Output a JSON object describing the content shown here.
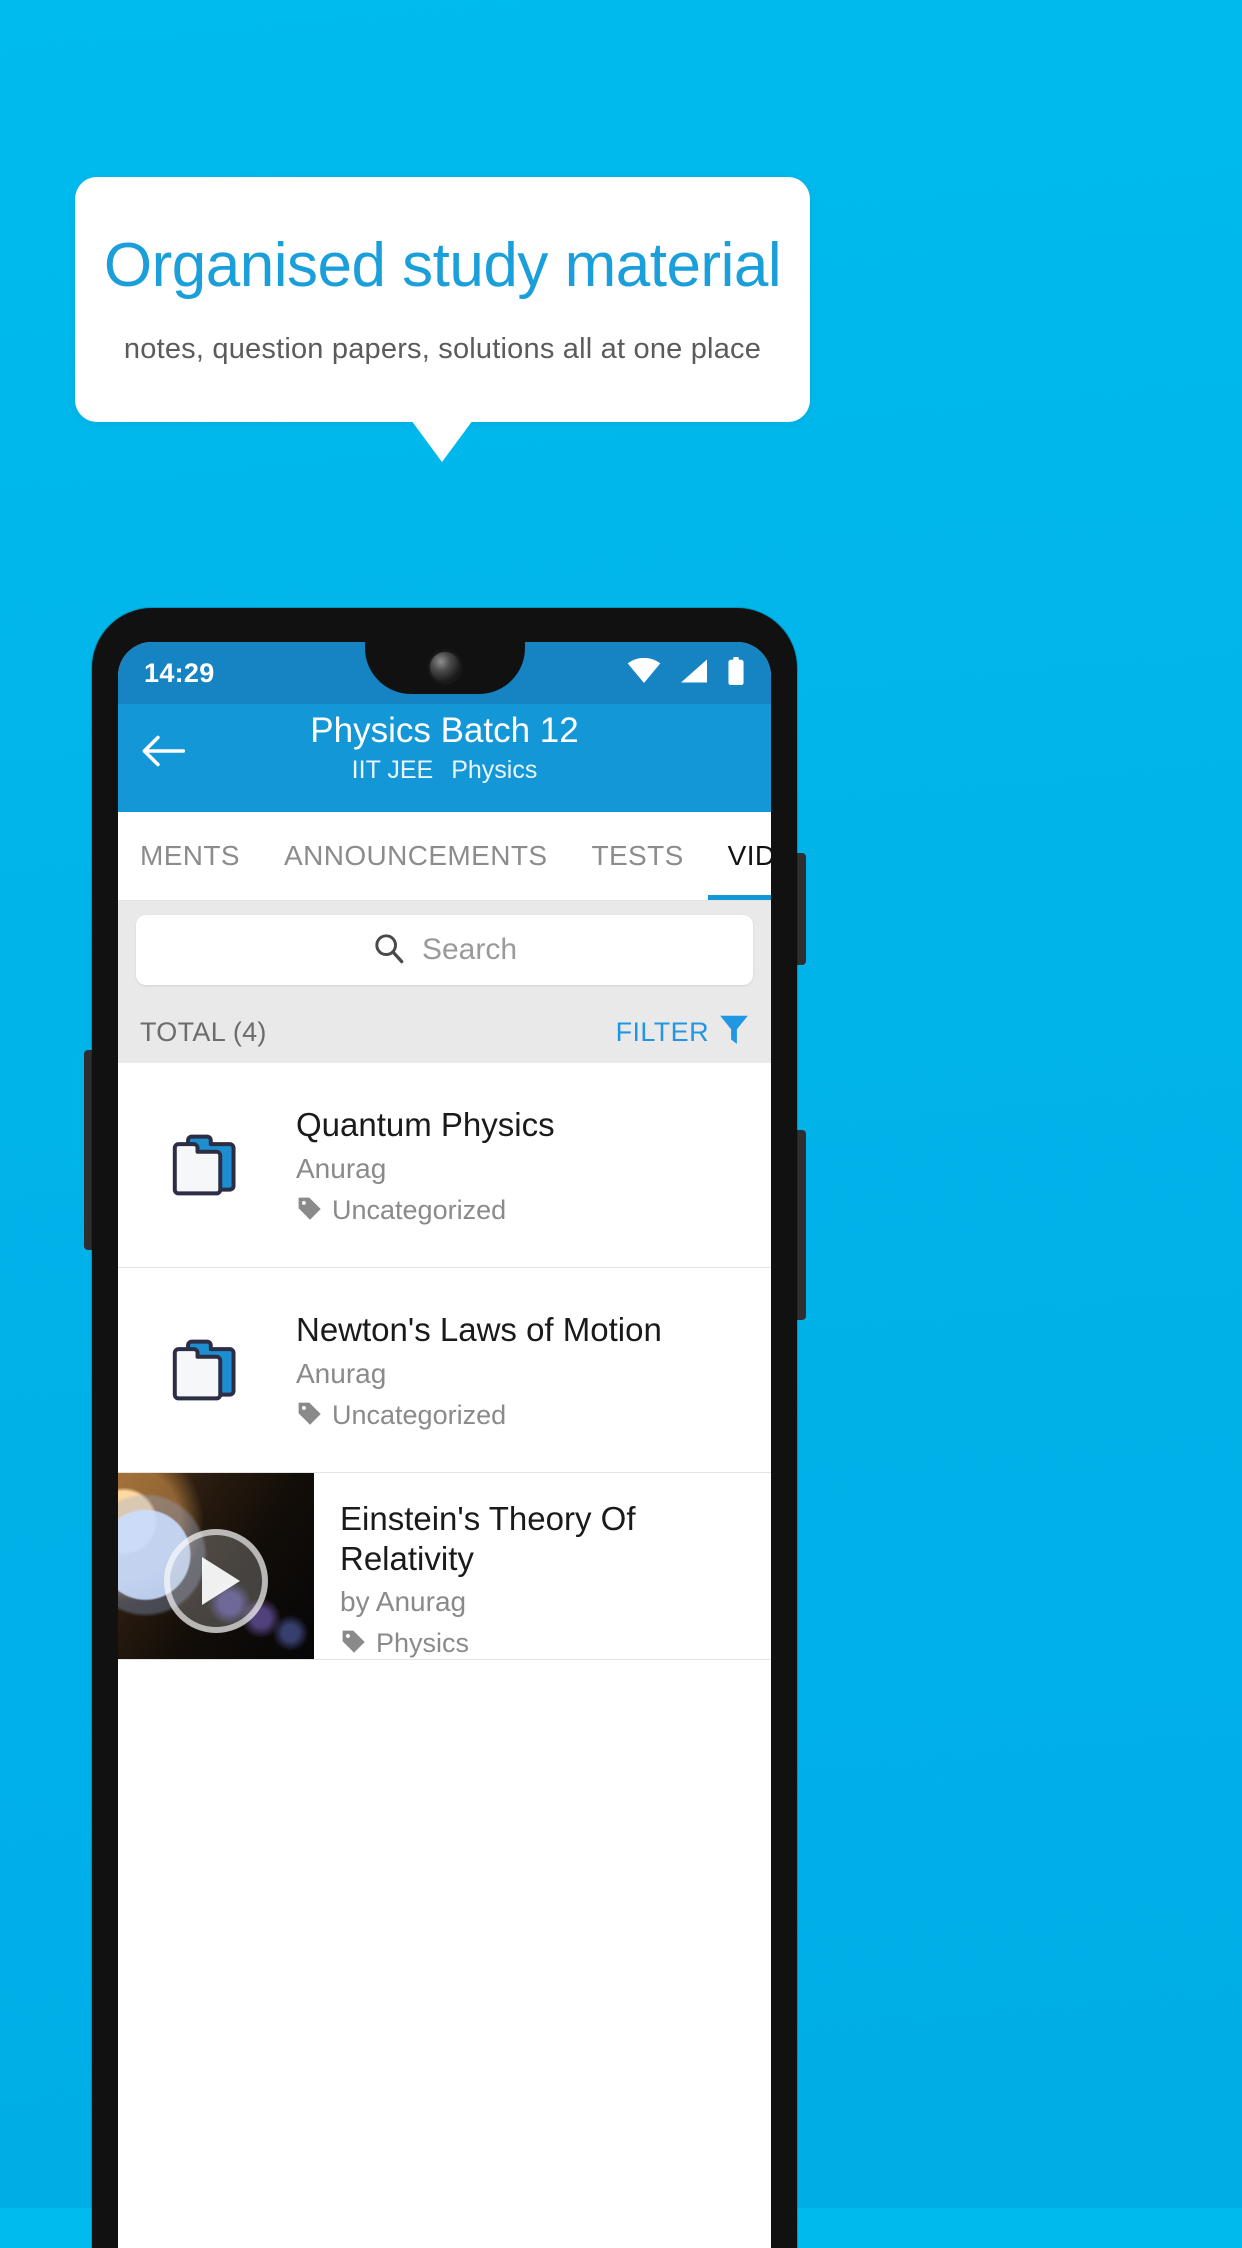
{
  "promo": {
    "title": "Organised study material",
    "subtitle": "notes, question papers, solutions all at one place",
    "title_color": "#1b9fdb",
    "background_color": "#00b5ea"
  },
  "status_bar": {
    "time": "14:29",
    "icons": [
      "wifi-icon",
      "cellular-signal-icon",
      "battery-icon"
    ],
    "background_color": "#1683c2"
  },
  "app_bar": {
    "back_icon": "back-arrow-icon",
    "title": "Physics Batch 12",
    "subtitle_exam": "IIT JEE",
    "subtitle_subject": "Physics",
    "background_color": "#1497d6"
  },
  "tabs": {
    "items": [
      {
        "label": "MENTS",
        "active": false
      },
      {
        "label": "ANNOUNCEMENTS",
        "active": false
      },
      {
        "label": "TESTS",
        "active": false
      },
      {
        "label": "VIDEOS",
        "active": true
      }
    ],
    "indicator_color": "#1497d6"
  },
  "search": {
    "placeholder": "Search",
    "value": "",
    "icon": "search-icon"
  },
  "meta": {
    "total_label": "TOTAL (4)",
    "filter_label": "FILTER",
    "filter_icon": "funnel-icon",
    "filter_color": "#2196e3"
  },
  "list": {
    "items": [
      {
        "type": "folder",
        "icon": "folder-stack-icon",
        "title": "Quantum Physics",
        "author": "Anurag",
        "tag_icon": "tag-icon",
        "tag": "Uncategorized"
      },
      {
        "type": "folder",
        "icon": "folder-stack-icon",
        "title": "Newton's Laws of Motion",
        "author": "Anurag",
        "tag_icon": "tag-icon",
        "tag": "Uncategorized"
      },
      {
        "type": "video",
        "thumbnail": "space-planet-thumbnail",
        "play_icon": "play-button-icon",
        "title": "Einstein's Theory Of Relativity",
        "author": "by Anurag",
        "tag_icon": "tag-icon",
        "tag": "Physics"
      }
    ]
  }
}
